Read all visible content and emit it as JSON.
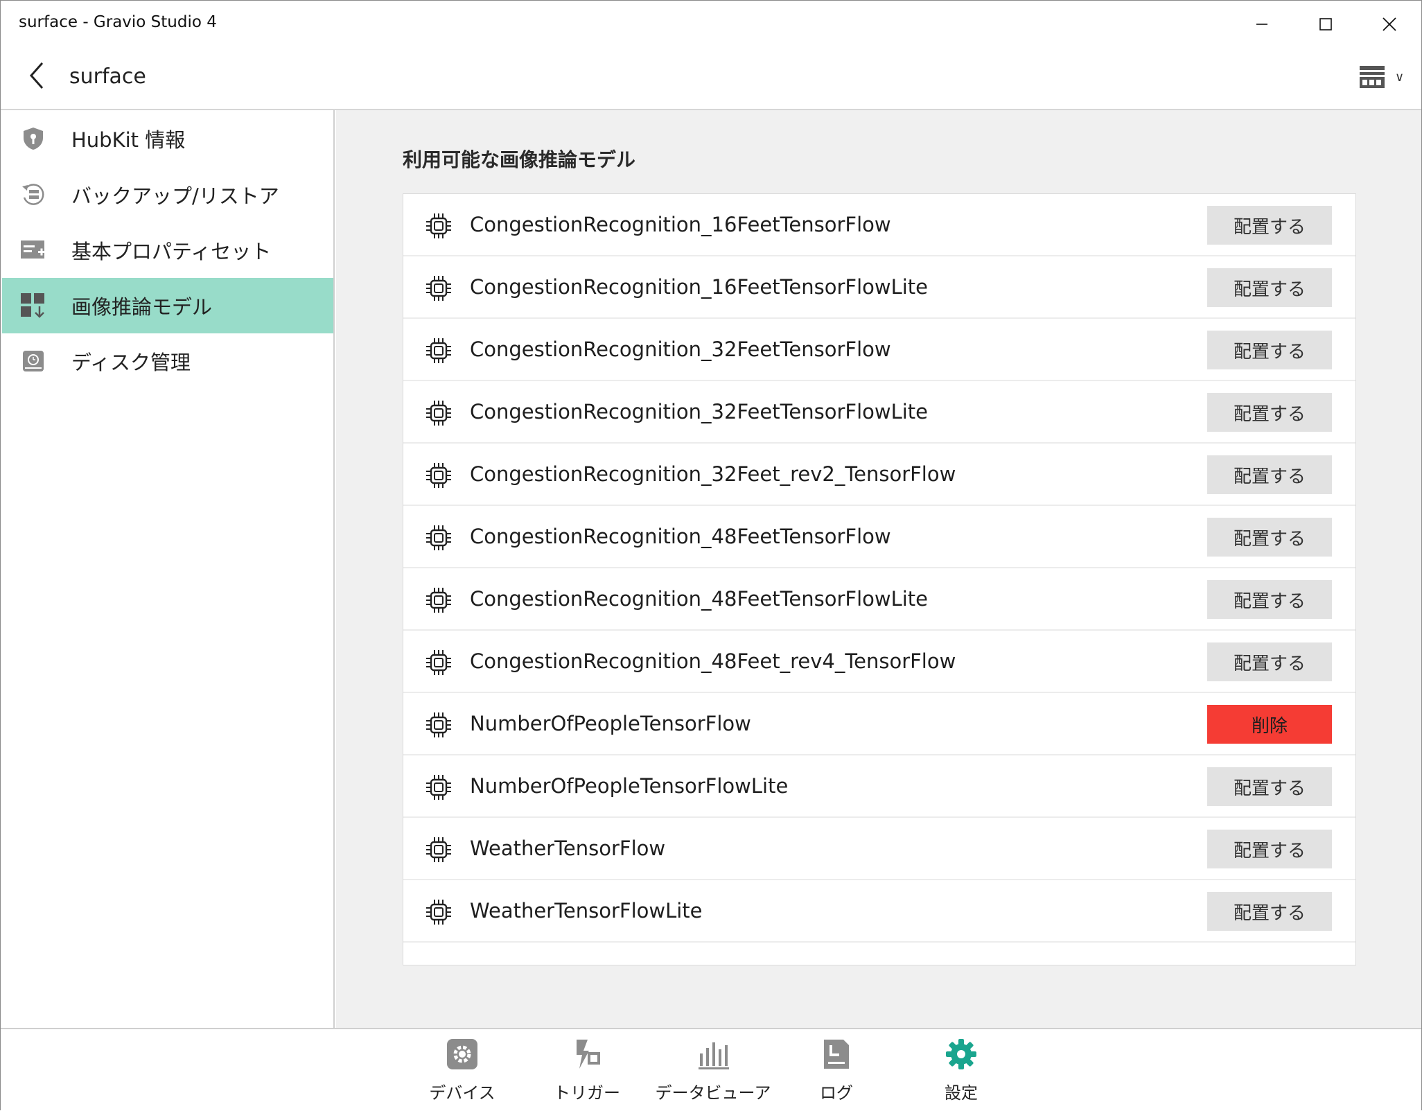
{
  "window": {
    "title": "surface - Gravio Studio 4"
  },
  "header": {
    "device_name": "surface",
    "layout_menu_caret": "∨"
  },
  "sidebar": {
    "items": [
      {
        "label": "HubKit 情報",
        "icon": "shield-key-icon"
      },
      {
        "label": "バックアップ/リストア",
        "icon": "backup-restore-icon"
      },
      {
        "label": "基本プロパティセット",
        "icon": "property-set-icon"
      },
      {
        "label": "画像推論モデル",
        "icon": "image-model-icon",
        "active": true
      },
      {
        "label": "ディスク管理",
        "icon": "disk-icon"
      }
    ]
  },
  "main": {
    "section_title": "利用可能な画像推論モデル",
    "models": [
      {
        "name": "CongestionRecognition_16FeetTensorFlow",
        "action": "配置する"
      },
      {
        "name": "CongestionRecognition_16FeetTensorFlowLite",
        "action": "配置する"
      },
      {
        "name": "CongestionRecognition_32FeetTensorFlow",
        "action": "配置する"
      },
      {
        "name": "CongestionRecognition_32FeetTensorFlowLite",
        "action": "配置する"
      },
      {
        "name": "CongestionRecognition_32Feet_rev2_TensorFlow",
        "action": "配置する"
      },
      {
        "name": "CongestionRecognition_48FeetTensorFlow",
        "action": "配置する"
      },
      {
        "name": "CongestionRecognition_48FeetTensorFlowLite",
        "action": "配置する"
      },
      {
        "name": "CongestionRecognition_48Feet_rev4_TensorFlow",
        "action": "配置する"
      },
      {
        "name": "NumberOfPeopleTensorFlow",
        "action": "削除"
      },
      {
        "name": "NumberOfPeopleTensorFlowLite",
        "action": "配置する"
      },
      {
        "name": "WeatherTensorFlow",
        "action": "配置する"
      },
      {
        "name": "WeatherTensorFlowLite",
        "action": "配置する"
      }
    ]
  },
  "bottom_tabs": [
    {
      "label": "デバイス",
      "icon": "device-icon"
    },
    {
      "label": "トリガー",
      "icon": "trigger-icon"
    },
    {
      "label": "データビューア",
      "icon": "data-viewer-icon"
    },
    {
      "label": "ログ",
      "icon": "log-icon"
    },
    {
      "label": "設定",
      "icon": "settings-gear-icon",
      "active": true
    }
  ],
  "colors": {
    "accent": "#98dcc9",
    "settings_active": "#1aa58e",
    "delete": "#f53c34",
    "deploy_button": "#e2e2e2",
    "icon_gray": "#8c8c8c"
  }
}
